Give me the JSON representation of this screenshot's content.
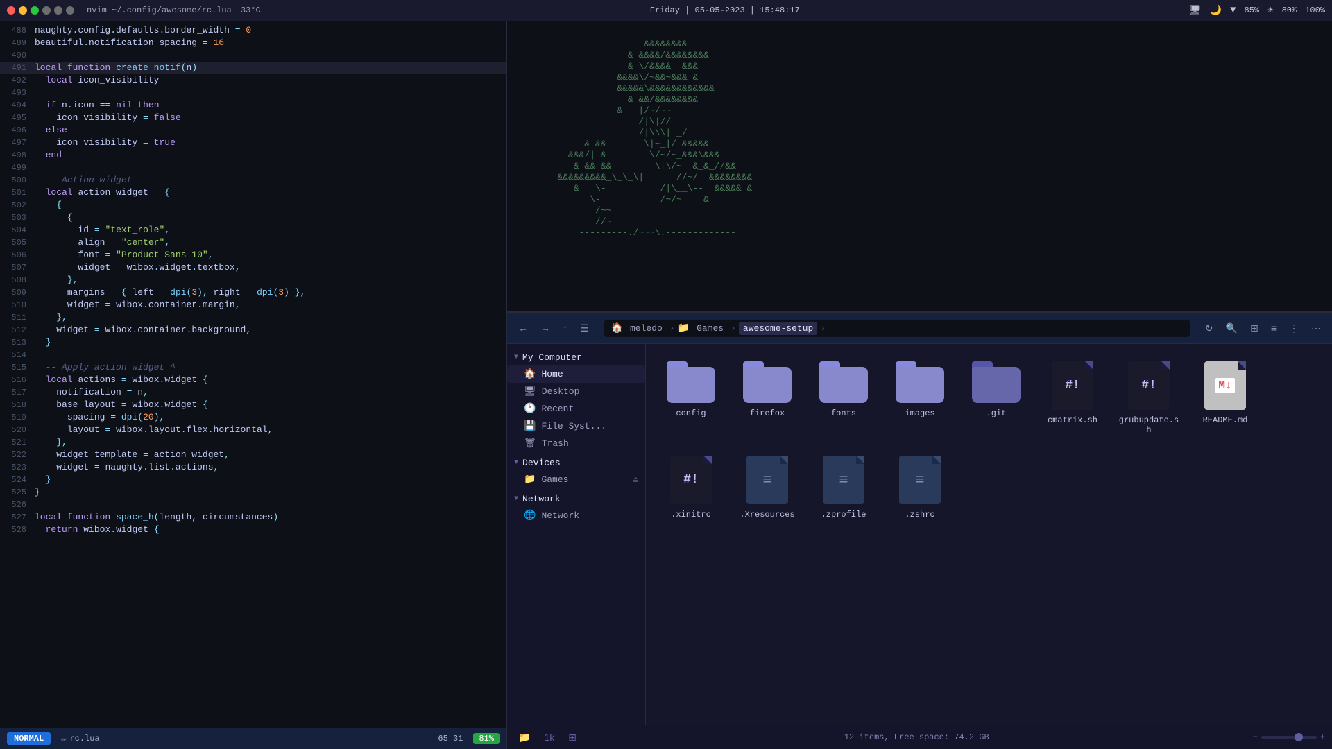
{
  "topbar": {
    "title": "nvim ~/.config/awesome/rc.lua",
    "datetime": "Friday  |  05-05-2023  |  15:48:17",
    "temp": "33°C",
    "volume": "85%",
    "brightness": "80%",
    "battery": "100%",
    "dots": [
      "red",
      "yellow",
      "green",
      "gray",
      "gray",
      "gray"
    ]
  },
  "code": {
    "lines": [
      {
        "num": "488",
        "content": "naughty.config.defaults.border_width = 0",
        "highlight": false
      },
      {
        "num": "489",
        "content": "beautiful.notification_spacing = 16",
        "highlight": false
      },
      {
        "num": "490",
        "content": "",
        "highlight": false
      },
      {
        "num": "491",
        "content": "local function create_notif(n)",
        "highlight": true
      },
      {
        "num": "492",
        "content": "  local icon_visibility",
        "highlight": false
      },
      {
        "num": "493",
        "content": "",
        "highlight": false
      },
      {
        "num": "494",
        "content": "  if n.icon == nil then",
        "highlight": false
      },
      {
        "num": "495",
        "content": "    icon_visibility = false",
        "highlight": false
      },
      {
        "num": "496",
        "content": "  else",
        "highlight": false
      },
      {
        "num": "497",
        "content": "    icon_visibility = true",
        "highlight": false
      },
      {
        "num": "498",
        "content": "  end",
        "highlight": false
      },
      {
        "num": "499",
        "content": "",
        "highlight": false
      },
      {
        "num": "500",
        "content": "  -- Action widget",
        "highlight": false
      },
      {
        "num": "501",
        "content": "  local action_widget = {",
        "highlight": false
      },
      {
        "num": "502",
        "content": "    {",
        "highlight": false
      },
      {
        "num": "503",
        "content": "      {",
        "highlight": false
      },
      {
        "num": "504",
        "content": "        id = \"text_role\",",
        "highlight": false
      },
      {
        "num": "505",
        "content": "        align = \"center\",",
        "highlight": false
      },
      {
        "num": "506",
        "content": "        font = \"Product Sans 10\",",
        "highlight": false
      },
      {
        "num": "507",
        "content": "        widget = wibox.widget.textbox,",
        "highlight": false
      },
      {
        "num": "508",
        "content": "      },",
        "highlight": false
      },
      {
        "num": "509",
        "content": "      margins = { left = dpi(3), right = dpi(3) },",
        "highlight": false
      },
      {
        "num": "510",
        "content": "      widget = wibox.container.margin,",
        "highlight": false
      },
      {
        "num": "511",
        "content": "    },",
        "highlight": false
      },
      {
        "num": "512",
        "content": "    widget = wibox.container.background,",
        "highlight": false
      },
      {
        "num": "513",
        "content": "  }",
        "highlight": false
      },
      {
        "num": "514",
        "content": "",
        "highlight": false
      },
      {
        "num": "515",
        "content": "  -- Apply action widget ^",
        "highlight": false
      },
      {
        "num": "516",
        "content": "  local actions = wibox.widget {",
        "highlight": false
      },
      {
        "num": "517",
        "content": "    notification = n,",
        "highlight": false
      },
      {
        "num": "518",
        "content": "    base_layout = wibox.widget {",
        "highlight": false
      },
      {
        "num": "519",
        "content": "      spacing = dpi(20),",
        "highlight": false
      },
      {
        "num": "520",
        "content": "      layout = wibox.layout.flex.horizontal,",
        "highlight": false
      },
      {
        "num": "521",
        "content": "    },",
        "highlight": false
      },
      {
        "num": "522",
        "content": "    widget_template = action_widget,",
        "highlight": false
      },
      {
        "num": "523",
        "content": "    widget = naughty.list.actions,",
        "highlight": false
      },
      {
        "num": "524",
        "content": "  }",
        "highlight": false
      },
      {
        "num": "525",
        "content": "}",
        "highlight": false
      },
      {
        "num": "526",
        "content": "",
        "highlight": false
      },
      {
        "num": "527",
        "content": "local function space_h(length, circumstances)",
        "highlight": false
      },
      {
        "num": "528",
        "content": "  return wibox.widget {",
        "highlight": false
      }
    ],
    "statusbar": {
      "mode": "NORMAL",
      "filename": "rc.lua",
      "line": "65",
      "col": "31",
      "battery_pct": "81%"
    }
  },
  "terminal": {
    "art_lines": [
      "                        &&&&&&&&",
      "                     & &&&&/&&&&&&&&",
      "                     & \\/&&&&  &&&",
      "                   &&&&\\/~&&~&&& &",
      "                   &&&&&\\&&&&&&&&&&&&",
      "                     & &&/&&&&&&&&",
      "                   &   |/~/~~",
      "                       /|\\|//",
      "                       /|\\\\| _/",
      "             & &&       \\|~_|/ &&&&&",
      "          &&&/| &        \\/~/~_&&&\\&&&",
      "           & && &&        \\|\\/~  &_&_//&&",
      "        &&&&&&&&&_\\_\\_\\|      //~/  &&&&&&&&",
      "           &   \\-          /|\\__\\--  &&&&& &",
      "              \\-           /~/~    &",
      "               /~~",
      "               //~",
      "            ---------./~~~\\.-------------"
    ]
  },
  "filemanager": {
    "toolbar": {
      "back_label": "←",
      "forward_label": "→",
      "up_label": "↑",
      "menu_label": "☰",
      "search_label": "⌕",
      "grid_label": "⊞",
      "list_label": "≡",
      "more_label": "⋮",
      "extra_label": "⋯"
    },
    "breadcrumb": {
      "items": [
        "meledo",
        "Games",
        "awesome-setup"
      ],
      "icons": [
        "🏠",
        "📁"
      ]
    },
    "sidebar": {
      "sections": [
        {
          "name": "My Computer",
          "expanded": true,
          "items": [
            {
              "label": "Home",
              "icon": "🏠"
            },
            {
              "label": "Desktop",
              "icon": "🖥"
            },
            {
              "label": "Recent",
              "icon": "🕐"
            },
            {
              "label": "File Syst...",
              "icon": "💾"
            },
            {
              "label": "Trash",
              "icon": "🗑"
            }
          ]
        },
        {
          "name": "Devices",
          "expanded": true,
          "items": [
            {
              "label": "Games",
              "icon": "📁",
              "eject": true
            }
          ]
        },
        {
          "name": "Network",
          "expanded": true,
          "items": [
            {
              "label": "Network",
              "icon": "🌐"
            }
          ]
        }
      ]
    },
    "files": [
      {
        "name": "config",
        "type": "folder"
      },
      {
        "name": "firefox",
        "type": "folder"
      },
      {
        "name": "fonts",
        "type": "folder"
      },
      {
        "name": "images",
        "type": "folder"
      },
      {
        "name": ".git",
        "type": "folder-dark"
      },
      {
        "name": "cmatrix.sh",
        "type": "script-hash"
      },
      {
        "name": "grubupdate.sh",
        "type": "script-hash"
      },
      {
        "name": "README.md",
        "type": "file-md"
      },
      {
        "name": ".xinitrc",
        "type": "script-hash"
      },
      {
        "name": ".Xresources",
        "type": "file-text"
      },
      {
        "name": ".zprofile",
        "type": "file-text"
      },
      {
        "name": ".zshrc",
        "type": "file-text"
      }
    ],
    "statusbar": {
      "item_count": "12 items, Free space: 74.2 GB",
      "zoom": 70
    }
  }
}
